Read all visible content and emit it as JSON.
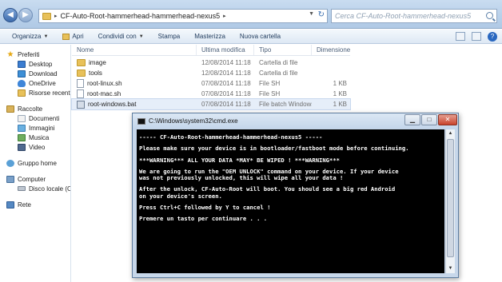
{
  "explorer": {
    "address_path": "CF-Auto-Root-hammerhead-hammerhead-nexus5",
    "search_placeholder": "Cerca CF-Auto-Root-hammerhead-nexus5"
  },
  "toolbar": {
    "items": [
      "Organizza",
      "Apri",
      "Condividi con",
      "Stampa",
      "Masterizza",
      "Nuova cartella"
    ]
  },
  "sidebar": {
    "favorites": {
      "label": "Preferiti",
      "items": [
        "Desktop",
        "Download",
        "OneDrive",
        "Risorse recenti"
      ]
    },
    "libraries": {
      "label": "Raccolte",
      "items": [
        "Documenti",
        "Immagini",
        "Musica",
        "Video"
      ]
    },
    "homegroup": "Gruppo home",
    "computer": {
      "label": "Computer",
      "items": [
        "Disco locale (C:"
      ]
    },
    "network": "Rete"
  },
  "columns": {
    "name": "Nome",
    "date": "Ultima modifica",
    "type": "Tipo",
    "size": "Dimensione"
  },
  "files": [
    {
      "name": "image",
      "date": "12/08/2014 11:18",
      "type": "Cartella di file",
      "size": "",
      "icon": "folder-icon"
    },
    {
      "name": "tools",
      "date": "12/08/2014 11:18",
      "type": "Cartella di file",
      "size": "",
      "icon": "folder-icon"
    },
    {
      "name": "root-linux.sh",
      "date": "07/08/2014 11:18",
      "type": "File SH",
      "size": "1 KB",
      "icon": "file-icon"
    },
    {
      "name": "root-mac.sh",
      "date": "07/08/2014 11:18",
      "type": "File SH",
      "size": "1 KB",
      "icon": "file-icon"
    },
    {
      "name": "root-windows.bat",
      "date": "07/08/2014 11:18",
      "type": "File batch Windows",
      "size": "1 KB",
      "icon": "batch-file-icon"
    }
  ],
  "cmd": {
    "title": "C:\\Windows\\system32\\cmd.exe",
    "lines": [
      "----- CF-Auto-Root-hammerhead-hammerhead-nexus5 -----",
      "",
      "Please make sure your device is in bootloader/fastboot mode before continuing.",
      "",
      "***WARNING*** ALL YOUR DATA *MAY* BE WIPED ! ***WARNING***",
      "",
      "We are going to run the \"OEM UNLOCK\" command on your device. If your device",
      "was not previously unlocked, this will wipe all your data !",
      "",
      "After the unlock, CF-Auto-Root will boot. You should see a big red Android",
      "on your device's screen.",
      "",
      "Press Ctrl+C followed by Y to cancel !",
      "",
      "Premere un tasto per continuare . . ."
    ]
  },
  "colors": {
    "titlebar": "#c3d5ea",
    "cmd_background": "#000000",
    "cmd_text": "#ffffff"
  }
}
